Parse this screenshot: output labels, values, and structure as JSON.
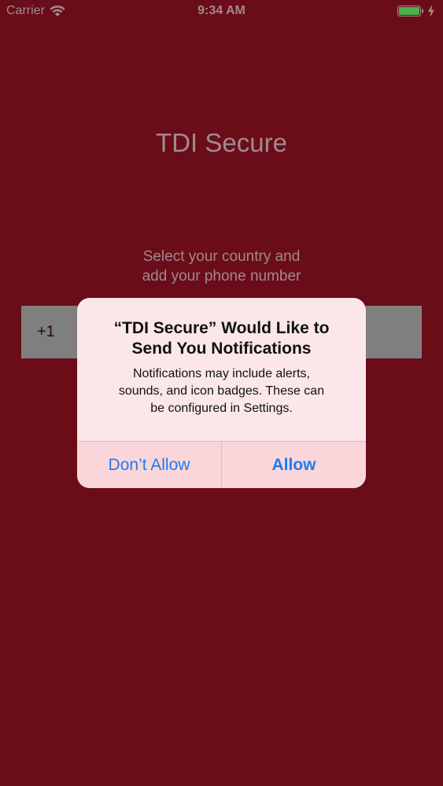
{
  "status_bar": {
    "carrier": "Carrier",
    "time": "9:34 AM",
    "wifi_icon": "wifi-icon",
    "battery_icon": "battery-icon",
    "charging_icon": "charging-bolt-icon"
  },
  "app": {
    "title": "TDI Secure",
    "instructions_line1": "Select your country and",
    "instructions_line2": "add your phone number",
    "country_code": "+1",
    "background_color": "#6B0C19"
  },
  "alert": {
    "title_line1": "“TDI Secure” Would Like to",
    "title_line2": "Send You Notifications",
    "message_line1": "Notifications may include alerts,",
    "message_line2": "sounds, and icon badges. These can",
    "message_line3": "be configured in Settings.",
    "dont_allow_label": "Don’t Allow",
    "allow_label": "Allow",
    "button_color": "#1E7BF2"
  }
}
